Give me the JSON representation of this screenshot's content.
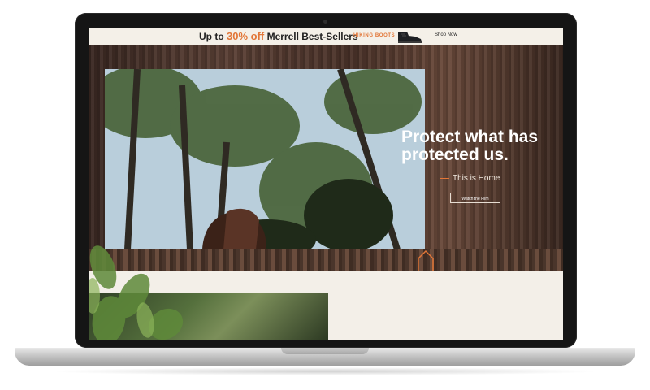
{
  "promo": {
    "prefix": "Up to ",
    "discount": "30% off",
    "title": " Merrell Best-Sellers",
    "tag": "HIKING BOOTS",
    "cta": "Shop Now"
  },
  "hero": {
    "headline": "Protect what has protected us.",
    "subtitle": "This is Home",
    "cta": "Watch the Film"
  },
  "colors": {
    "accent": "#e27637",
    "cream": "#f3efe8"
  },
  "icons": {
    "home": "home-outline-icon",
    "boot": "hiking-boot-icon"
  }
}
